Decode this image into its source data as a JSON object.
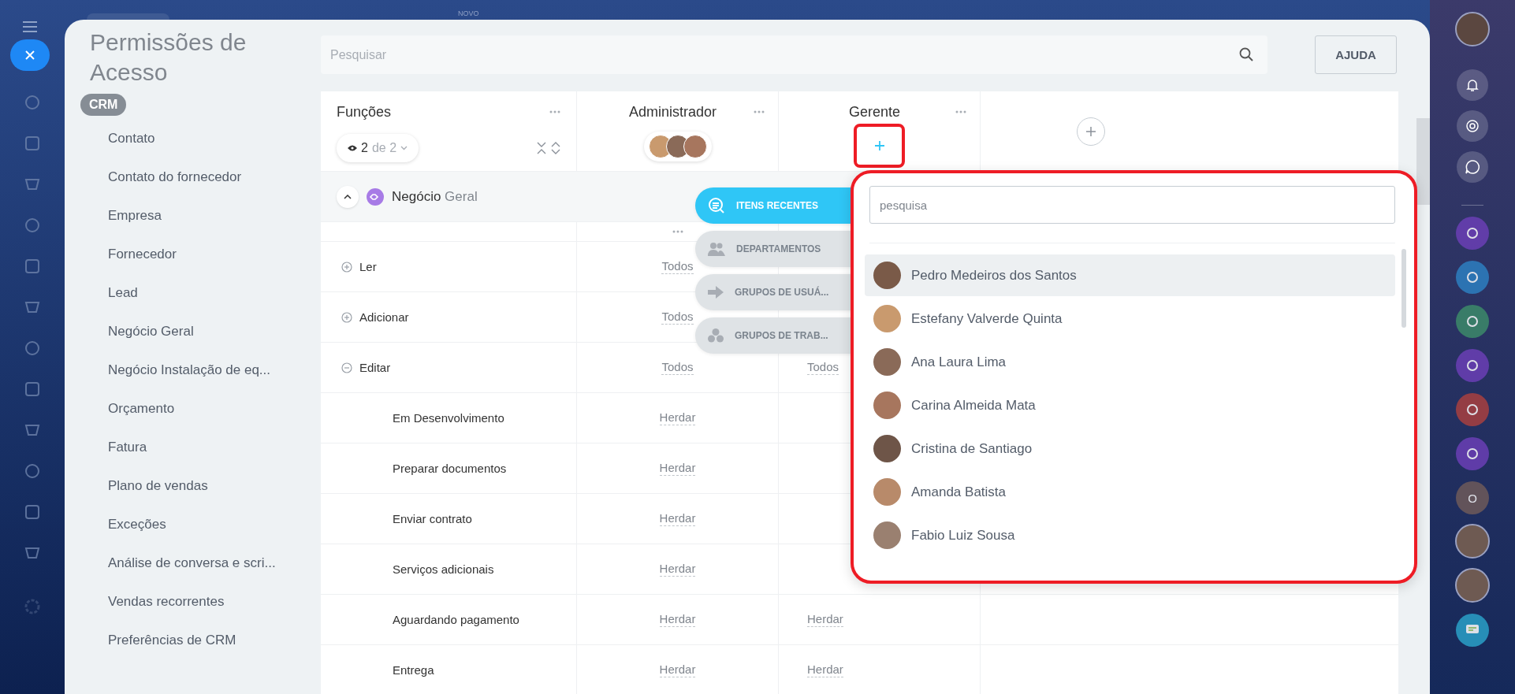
{
  "top_bar": {
    "badge": "NOVO"
  },
  "panel": {
    "title": "Permissões de Acesso",
    "section": "CRM",
    "items": [
      "Contato",
      "Contato do fornecedor",
      "Empresa",
      "Fornecedor",
      "Lead",
      "Negócio Geral",
      "Negócio Instalação de eq...",
      "Orçamento",
      "Fatura",
      "Plano de vendas",
      "Exceções",
      "Análise de conversa e scri...",
      "Vendas recorrentes",
      "Preferências de CRM"
    ]
  },
  "search": {
    "placeholder": "Pesquisar"
  },
  "help_button": "AJUDA",
  "table": {
    "roles_title": "Funções",
    "columns": [
      {
        "title": "Administrador"
      },
      {
        "title": "Gerente"
      }
    ],
    "filter": {
      "shown": "2",
      "total": "de 2"
    },
    "group": {
      "name": "Negócio",
      "suffix": "Geral",
      "expanded": true
    },
    "rows": [
      {
        "label": "Ler",
        "kind": "action",
        "expanded": false,
        "cells": [
          "Todos"
        ]
      },
      {
        "label": "Adicionar",
        "kind": "action",
        "expanded": false,
        "cells": [
          "Todos"
        ]
      },
      {
        "label": "Editar",
        "kind": "action",
        "expanded": true,
        "cells": [
          "Todos",
          "Todos"
        ]
      },
      {
        "label": "Em Desenvolvimento",
        "kind": "stage",
        "cells": [
          "Herdar"
        ]
      },
      {
        "label": "Preparar documentos",
        "kind": "stage",
        "cells": [
          "Herdar"
        ]
      },
      {
        "label": "Enviar contrato",
        "kind": "stage",
        "cells": [
          "Herdar"
        ]
      },
      {
        "label": "Serviços adicionais",
        "kind": "stage",
        "cells": [
          "Herdar"
        ]
      },
      {
        "label": "Aguardando pagamento",
        "kind": "stage",
        "cells": [
          "Herdar",
          "Herdar"
        ]
      },
      {
        "label": "Entrega",
        "kind": "stage",
        "cells": [
          "Herdar",
          "Herdar"
        ]
      }
    ]
  },
  "picker": {
    "tabs": [
      {
        "label": "ITENS RECENTES",
        "kind": "recent",
        "selected": true
      },
      {
        "label": "DEPARTAMENTOS",
        "kind": "departments",
        "selected": false
      },
      {
        "label": "GRUPOS DE USUÁ...",
        "kind": "user-groups",
        "selected": false
      },
      {
        "label": "GRUPOS DE TRAB...",
        "kind": "workgroups",
        "selected": false
      }
    ],
    "search_placeholder": "pesquisa",
    "people": [
      {
        "name": "Pedro Medeiros dos Santos",
        "selected": true
      },
      {
        "name": "Estefany Valverde Quinta",
        "selected": false
      },
      {
        "name": "Ana Laura Lima",
        "selected": false
      },
      {
        "name": "Carina Almeida Mata",
        "selected": false
      },
      {
        "name": "Cristina de Santiago",
        "selected": false
      },
      {
        "name": "Amanda Batista",
        "selected": false
      },
      {
        "name": "Fabio Luiz Sousa",
        "selected": false
      }
    ]
  },
  "dock": {
    "initial": "O"
  }
}
